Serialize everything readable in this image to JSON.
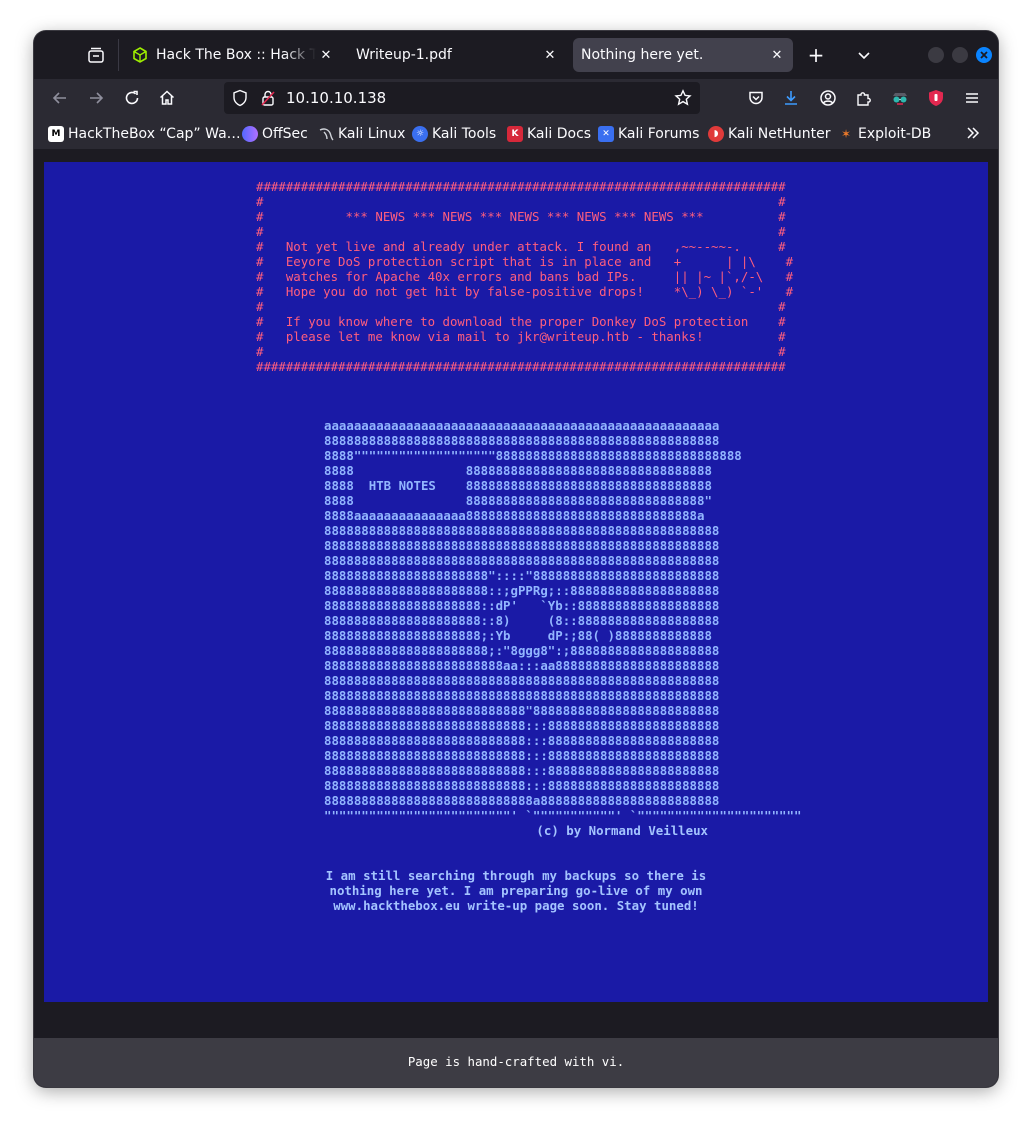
{
  "browser": {
    "tabs": [
      {
        "title": "Hack The Box :: Hack The Box",
        "active": false,
        "favicon": "hackthebox-cube-icon"
      },
      {
        "title": "Writeup-1.pdf",
        "active": false,
        "favicon": "none"
      },
      {
        "title": "Nothing here yet.",
        "active": true,
        "favicon": "none"
      }
    ],
    "url": "10.10.10.138",
    "bookmarks": [
      {
        "label": "HackTheBox “Cap” Wa…",
        "icon": "medium-icon"
      },
      {
        "label": "OffSec",
        "icon": "offsec-icon"
      },
      {
        "label": "Kali Linux",
        "icon": "kali-dragon-icon"
      },
      {
        "label": "Kali Tools",
        "icon": "kali-tools-icon"
      },
      {
        "label": "Kali Docs",
        "icon": "kali-docs-icon"
      },
      {
        "label": "Kali Forums",
        "icon": "kali-forums-icon"
      },
      {
        "label": "Kali NetHunter",
        "icon": "kali-nethunter-icon"
      },
      {
        "label": "Exploit-DB",
        "icon": "exploit-db-icon"
      }
    ]
  },
  "page": {
    "news_box": "#######################################################################\n#                                                                     #\n#           *** NEWS *** NEWS *** NEWS *** NEWS *** NEWS ***          #\n#                                                                     #\n#   Not yet live and already under attack. I found an   ,~~--~~-.     #\n#   Eeyore DoS protection script that is in place and   +      | |\\    #\n#   watches for Apache 40x errors and bans bad IPs.     || |~ |`,/-\\   #\n#   Hope you do not get hit by false-positive drops!    *\\_) \\_) `-'   #\n#                                                                     #\n#   If you know where to download the proper Donkey DoS protection    #\n#   please let me know via mail to jkr@writeup.htb - thanks!          #\n#                                                                     #\n#######################################################################",
    "ascii_art": "aaaaaaaaaaaaaaaaaaaaaaaaaaaaaaaaaaaaaaaaaaaaaaaaaaaaa\n88888888888888888888888888888888888888888888888888888\n8888\"\"\"\"\"\"\"\"\"\"\"\"\"\"\"\"\"\"\"888888888888888888888888888888888\n8888               888888888888888888888888888888888\n8888  HTB NOTES    888888888888888888888888888888888\n8888               88888888888888888888888888888888\"\n8888aaaaaaaaaaaaaaa8888888888888888888888888888888a\n88888888888888888888888888888888888888888888888888888\n88888888888888888888888888888888888888888888888888888\n88888888888888888888888888888888888888888888888888888\n8888888888888888888888\"::::\"8888888888888888888888888\n8888888888888888888888::;gPPRg;::88888888888888888888\n888888888888888888888::dP'   `Yb::8888888888888888888\n888888888888888888888::8)     (8::8888888888888888888\n888888888888888888888;:Yb     dP:;88( )8888888888888\n8888888888888888888888;:\"8ggg8\":;88888888888888888888\n888888888888888888888888aa:::aa8888888888888888888888\n88888888888888888888888888888888888888888888888888888\n88888888888888888888888888888888888888888888888888888\n888888888888888888888888888\"8888888888888888888888888\n888888888888888888888888888:::88888888888888888888888\n888888888888888888888888888:::88888888888888888888888\n888888888888888888888888888:::88888888888888888888888\n888888888888888888888888888:::88888888888888888888888\n888888888888888888888888888:::88888888888888888888888\n8888888888888888888888888888a888888888888888888888888\n\"\"\"\"\"\"\"\"\"\"\"\"\"\"\"\"\"\"\"\"\"\"\"\"\"' `\"\"\"\"\"\"\"\"\"\"\"' `\"\"\"\"\"\"\"\"\"\"\"\"\"\"\"\"\"\"\"\"\"\"",
    "credit": "(c) by Normand Veilleux",
    "message_lines": [
      "I am still searching through my backups so there is",
      "nothing here yet. I am preparing go-live of my own",
      "www.hackthebox.eu write-up page soon. Stay tuned!"
    ],
    "footer": "Page is hand-crafted with vi."
  },
  "colors": {
    "panel_bg": "#1a1aa6",
    "news_text": "#ff5e7e",
    "art_text": "#92b6ff",
    "footer_bg": "#3d3c44"
  }
}
